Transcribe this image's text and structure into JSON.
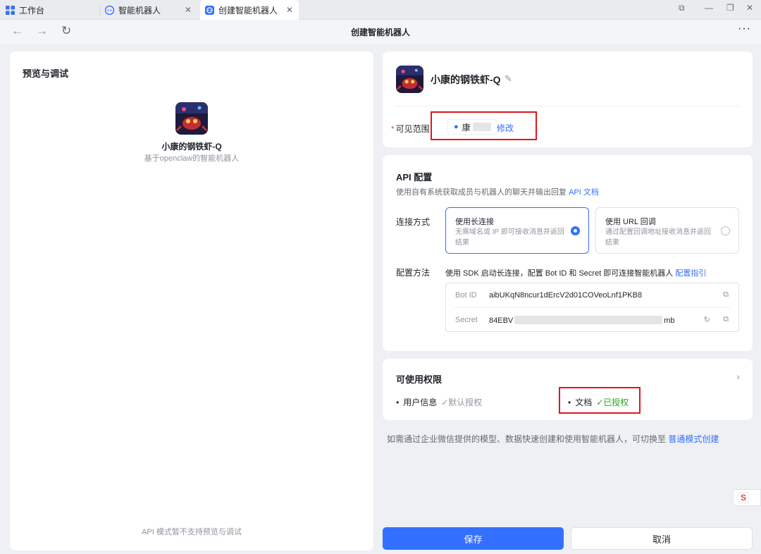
{
  "tabs": [
    {
      "label": "工作台",
      "active": false
    },
    {
      "label": "智能机器人",
      "active": false
    },
    {
      "label": "创建智能机器人",
      "active": true
    }
  ],
  "toolbar": {
    "title": "创建智能机器人",
    "more": "···"
  },
  "left_panel": {
    "title": "预览与调试",
    "bot_name": "小康的钢铁虾-Q",
    "bot_desc": "基于openclaw的智能机器人",
    "footer_note": "API 模式暂不支持预览与调试"
  },
  "profile": {
    "bot_name": "小康的钢铁虾-Q",
    "visibility_required_mark": "*",
    "visibility_label": "可见范围",
    "visibility_user": "康",
    "visibility_edit": "修改"
  },
  "api_config": {
    "title": "API 配置",
    "desc_text": "使用自有系统获取成员与机器人的聊天并输出回复",
    "doc_link": "API 文档",
    "connect_label": "连接方式",
    "options": [
      {
        "title": "使用长连接",
        "desc": "无需域名或 IP 即可接收消息并返回结果",
        "selected": true
      },
      {
        "title": "使用 URL 回调",
        "desc": "通过配置回调地址接收消息并返回结果",
        "selected": false
      }
    ],
    "method_label": "配置方法",
    "method_text": "使用 SDK 启动长连接，配置 Bot ID 和 Secret 即可连接智能机器人",
    "guide_link": "配置指引",
    "bot_id_key": "Bot ID",
    "bot_id_value": "aibUKqN8ncur1dErcV2d01COVeoLnf1PKB8",
    "secret_key": "Secret",
    "secret_prefix": "84EBV",
    "secret_suffix": "mb"
  },
  "permissions": {
    "title": "可使用权限",
    "items": [
      {
        "name": "用户信息",
        "status": "默认授权",
        "granted": false
      },
      {
        "name": "文档",
        "status": "已授权",
        "granted": true
      }
    ]
  },
  "footnote": {
    "text": "如需通过企业微信提供的模型、数据快速创建和使用智能机器人，可切换至",
    "link": "普通模式创建"
  },
  "buttons": {
    "save": "保存",
    "cancel": "取消"
  },
  "colors": {
    "accent": "#3370ff",
    "success": "#2ea121",
    "highlight": "#e0161d",
    "required": "#f54a45"
  },
  "icons": [
    "workbench-icon",
    "robot-icon",
    "back-arrow-icon",
    "forward-arrow-icon",
    "refresh-icon",
    "more-icon",
    "edit-icon",
    "user-icon",
    "copy-icon",
    "regenerate-icon",
    "chevron-right-icon",
    "check-icon"
  ]
}
